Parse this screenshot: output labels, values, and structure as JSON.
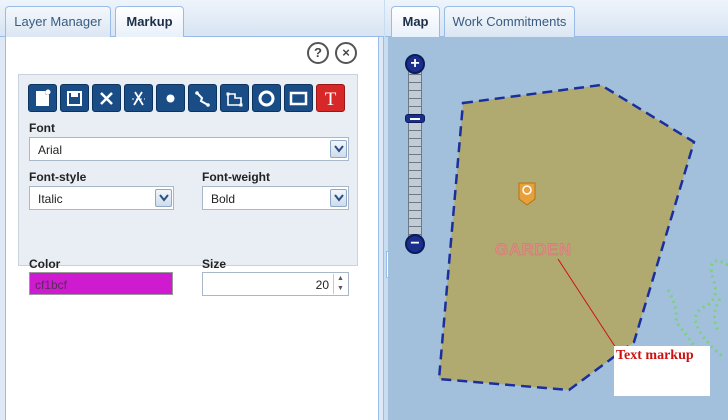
{
  "left_panel": {
    "tabs": [
      {
        "label": "Layer Manager",
        "active": false
      },
      {
        "label": "Markup",
        "active": true
      }
    ],
    "help_label": "?",
    "close_label": "×",
    "toolbar": [
      {
        "name": "new-markup-icon"
      },
      {
        "name": "save-icon"
      },
      {
        "name": "delete-icon"
      },
      {
        "name": "clear-selection-icon"
      },
      {
        "name": "point-icon"
      },
      {
        "name": "polyline-icon"
      },
      {
        "name": "polygon-icon"
      },
      {
        "name": "circle-icon"
      },
      {
        "name": "rectangle-icon"
      },
      {
        "name": "text-icon",
        "label": "T",
        "active": true
      }
    ],
    "form": {
      "font_label": "Font",
      "font_value": "Arial",
      "font_style_label": "Font-style",
      "font_style_value": "Italic",
      "font_weight_label": "Font-weight",
      "font_weight_value": "Bold",
      "color_label": "Color",
      "color_value": "cf1bcf",
      "size_label": "Size",
      "size_value": "20"
    }
  },
  "splitter": {
    "collapse_label": "‹"
  },
  "right_panel": {
    "tabs": [
      {
        "label": "Map",
        "active": true
      },
      {
        "label": "Work Commitments",
        "active": false
      }
    ],
    "map": {
      "zoom_in_label": "+",
      "zoom_out_label": "−",
      "garden_text": "GARDEN",
      "callout_text": "Text markup",
      "colors": {
        "polygon_fill": "#b1aa70",
        "polygon_stroke": "#1b2f9c",
        "water": "#a2c0dc",
        "path": "#7bd17b",
        "marker": "#e8a03a",
        "leader": "#cc1111"
      }
    }
  }
}
